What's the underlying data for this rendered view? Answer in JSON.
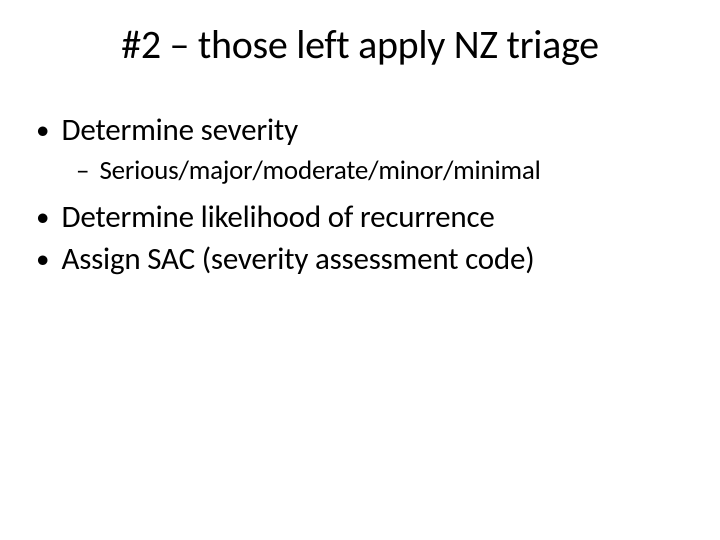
{
  "slide": {
    "title": "#2 – those left apply NZ triage",
    "bullets": [
      {
        "level": 1,
        "text": "Determine severity"
      },
      {
        "level": 2,
        "text": "Serious/major/moderate/minor/minimal"
      },
      {
        "level": 1,
        "text": "Determine likelihood of recurrence"
      },
      {
        "level": 1,
        "text": "Assign SAC (severity assessment code)"
      }
    ]
  }
}
